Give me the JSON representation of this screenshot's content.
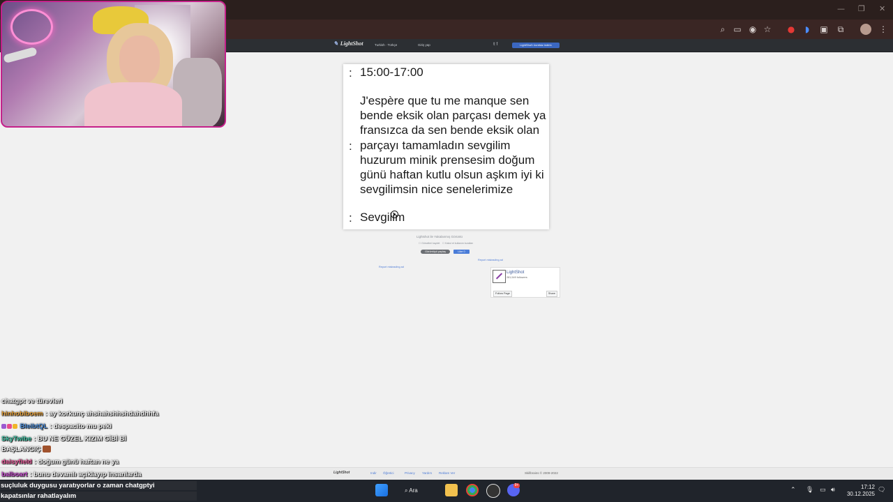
{
  "lightshot": {
    "logo": "LightShot",
    "nav_language": "Turkish · Türkçe",
    "nav_login": "Giriş yap",
    "social": "𝕥 f",
    "header_button": "LightShot'ı ücretsiz indirin",
    "screenshot": {
      "row1_colon": ":",
      "row1_text": "15:00-17:00",
      "row2_colon": ":",
      "row2_text": "J'espère que tu me manque sen bende eksik olan parçası demek ya  fransızca da sen bende eksik olan parçayı tamamladın sevgilim huzurum minik prensesim doğum günü haftan kutlu olsun aşkım iyi ki sevgilimsin nice senelerimize",
      "row3_colon": ":",
      "row3_text": "Sevgilim"
    },
    "caption": "Lightshot ile Yakalanmış Görüntü",
    "caption_sub_left": "☐ Görselleri kaydet",
    "caption_sub_right": "☐ Kabul et kullanım kuralları",
    "share_button": "Görüntüyü paylaş",
    "like_button": "Like 0",
    "report_left": "Report misleading ad",
    "report_right": "Report misleading ad",
    "fb_name": "LightShot",
    "fb_followers": "281,549 followers",
    "fb_follow": "Follow Page",
    "fb_share": "Share",
    "footer_logo": "LightShot",
    "footer_links": [
      "Indir",
      "Öğretici",
      "Privacy",
      "Yardım",
      "Reklam Ver"
    ],
    "copyright": "Skillbrains © 2009-2022"
  },
  "chat": [
    {
      "user": "",
      "message": "chatgpt ve türevleri",
      "color": "#ffffff"
    },
    {
      "user": "hinhobiboem",
      "message": ": ay korkunç ahshahshhshdahdhhfa",
      "color": "#e8a23a"
    },
    {
      "user": "BleibtQL",
      "message": ": despacito mu peki",
      "color": "#4f8fd9"
    },
    {
      "user": "SkyTwibe",
      "message": ": BU NE GÜZEL KIZIM GİBİ Bİ",
      "color": "#45c6a8"
    },
    {
      "user": "",
      "message": "BAŞLANGIÇ",
      "color": "#ffffff"
    },
    {
      "user": "daisyfield",
      "message": ": doğum günü haftan ne ya",
      "color": "#e85a9a"
    },
    {
      "user": "balboart",
      "message": ": bunu devamlı açıklayıp insanlarda",
      "color": "#c94fd1"
    }
  ],
  "caption_overlay": {
    "line1": "suçluluk duygusu yaratıyorlar o zaman chatgptyi",
    "line2": "kapatsınlar rahatlayalım"
  },
  "taskbar": {
    "search_label": "Ara",
    "discord_badge": "9+",
    "time": "17:12",
    "date": "30.12.2025"
  }
}
